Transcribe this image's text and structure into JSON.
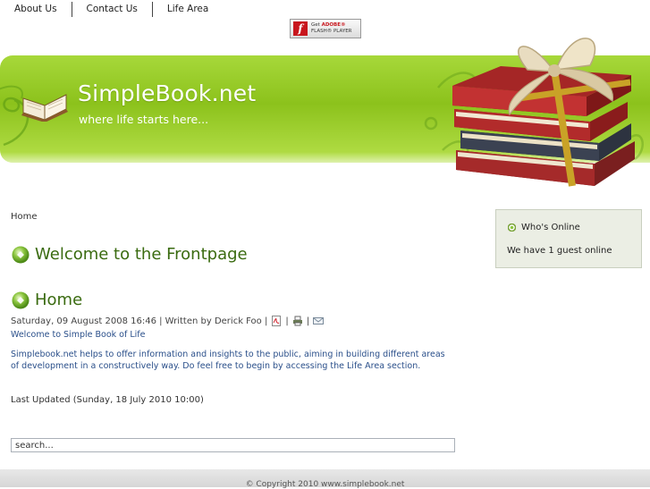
{
  "nav": {
    "items": [
      {
        "label": "About Us"
      },
      {
        "label": "Contact Us"
      },
      {
        "label": "Life Area"
      }
    ]
  },
  "flash_badge": {
    "line1_prefix": "Get ",
    "line1_brand": "ADOBE®",
    "line2": "FLASH® PLAYER",
    "logo_glyph": "f"
  },
  "header": {
    "site_title": "SimpleBook.net",
    "slogan": "where life starts here..."
  },
  "breadcrumb": "Home",
  "main": {
    "frontpage_heading": "Welcome to the Frontpage",
    "article": {
      "title": "Home",
      "meta": "Saturday, 09 August 2008 16:46 | Written by Derick Foo |",
      "separator": "|",
      "intro": "Welcome to Simple Book of Life",
      "body": "Simplebook.net helps to offer information and insights to the public, aiming in building different areas of development in a constructively way. Do feel free to begin by accessing the Life Area section.",
      "last_updated": "Last Updated (Sunday, 18 July 2010 10:00)"
    }
  },
  "search": {
    "value": "search..."
  },
  "sidebar": {
    "online_title": "Who's Online",
    "online_text": "We have 1 guest online"
  },
  "footer": {
    "copyright": "© Copyright 2010 www.simplebook.net"
  },
  "colors": {
    "banner_green": "#8cc21c",
    "heading_green": "#3a6b10",
    "link_blue": "#2a4f8a"
  },
  "icons": [
    "pdf-icon",
    "print-icon",
    "email-icon",
    "flash-logo-icon",
    "open-book-icon",
    "gift-books-image",
    "bullet-orb-icon"
  ]
}
